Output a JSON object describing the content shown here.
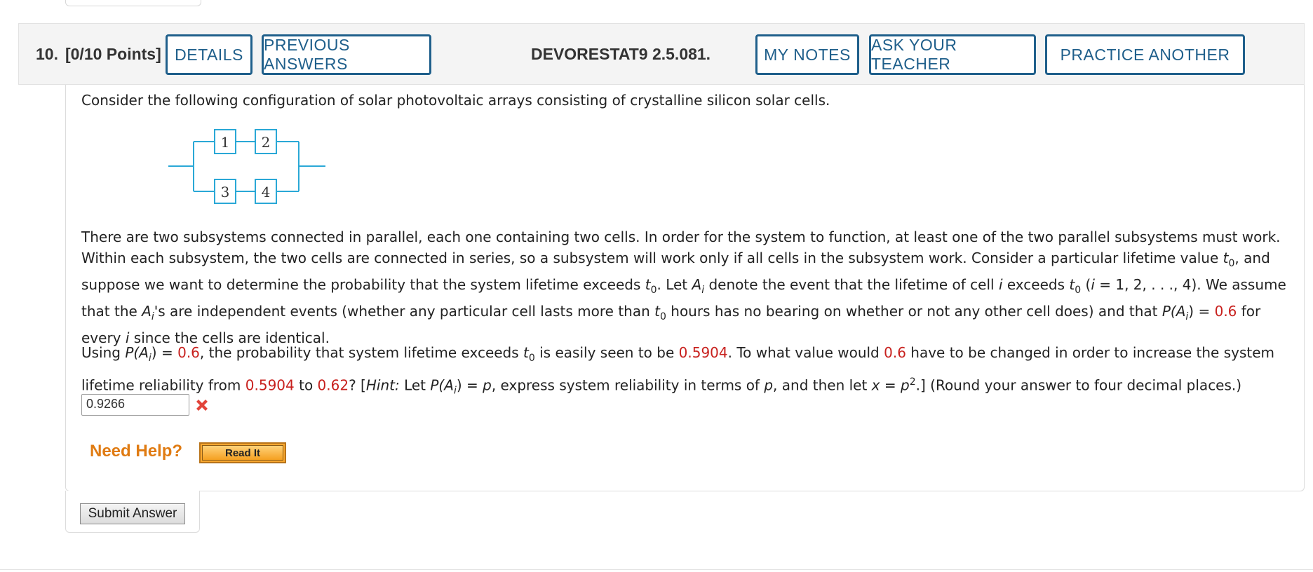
{
  "question": {
    "number": "10.",
    "points": "[0/10 Points]",
    "assignment_code": "DEVORESTAT9 2.5.081."
  },
  "header_buttons": {
    "details": "DETAILS",
    "previous_answers": "PREVIOUS ANSWERS",
    "my_notes": "MY NOTES",
    "ask_teacher": "ASK YOUR TEACHER",
    "practice_another": "PRACTICE ANOTHER"
  },
  "body": {
    "intro": "Consider the following configuration of solar photovoltaic arrays consisting of crystalline silicon solar cells.",
    "paragraph2": {
      "s1": "There are two subsystems connected in parallel, each one containing two cells. In order for the system to function, at least one of the two parallel subsystems must work. Within each subsystem, the two cells are connected in series, so a subsystem will work only if all cells in the subsystem work. Consider a particular lifetime value ",
      "s2": ", and suppose we want to determine the probability that the system lifetime exceeds ",
      "s3": ". Let ",
      "s4": " denote the event that the lifetime of cell ",
      "s5": " exceeds ",
      "s6": " (",
      "s7": " = 1, 2, . . ., 4). We assume that the ",
      "s8": "'s are independent events (whether any particular cell lasts more than ",
      "s9": " hours has no bearing on whether or not any other cell does) and that ",
      "s10": " = ",
      "s11": " for every ",
      "s12": " since the cells are identical."
    },
    "paragraph3": {
      "s1": "Using ",
      "s2": " = ",
      "s3": ", the probability that system lifetime exceeds ",
      "s4": " is easily seen to be ",
      "s5": ". To what value would ",
      "s6": " have to be changed in order to increase the system lifetime reliability from ",
      "s7": " to ",
      "s8": "? [",
      "hint": "Hint:",
      "s9": " Let ",
      "s10": " = ",
      "s11": ", express system reliability in terms of ",
      "s12": ", and then let ",
      "s13": " = ",
      "s14": ".] (Round your answer to four decimal places.)"
    },
    "sym": {
      "t": "t",
      "zero": "0",
      "A": "A",
      "i": "i",
      "P_open": "P(",
      "close": ")",
      "p": "p",
      "x": "x",
      "two": "2",
      "apos": "'"
    },
    "values": {
      "prob": "0.6",
      "reliability": "0.5904",
      "target": "0.62"
    }
  },
  "diagram": {
    "cells": [
      "1",
      "2",
      "3",
      "4"
    ]
  },
  "answer": {
    "value": "0.9266",
    "status": "incorrect"
  },
  "help": {
    "label": "Need Help?",
    "read_it": "Read It"
  },
  "submit": {
    "label": "Submit Answer"
  },
  "colors": {
    "accent": "#1f5f8b",
    "red_value": "#c8211e",
    "help_orange": "#e07b12",
    "diagram_cyan": "#2aa8d6"
  }
}
